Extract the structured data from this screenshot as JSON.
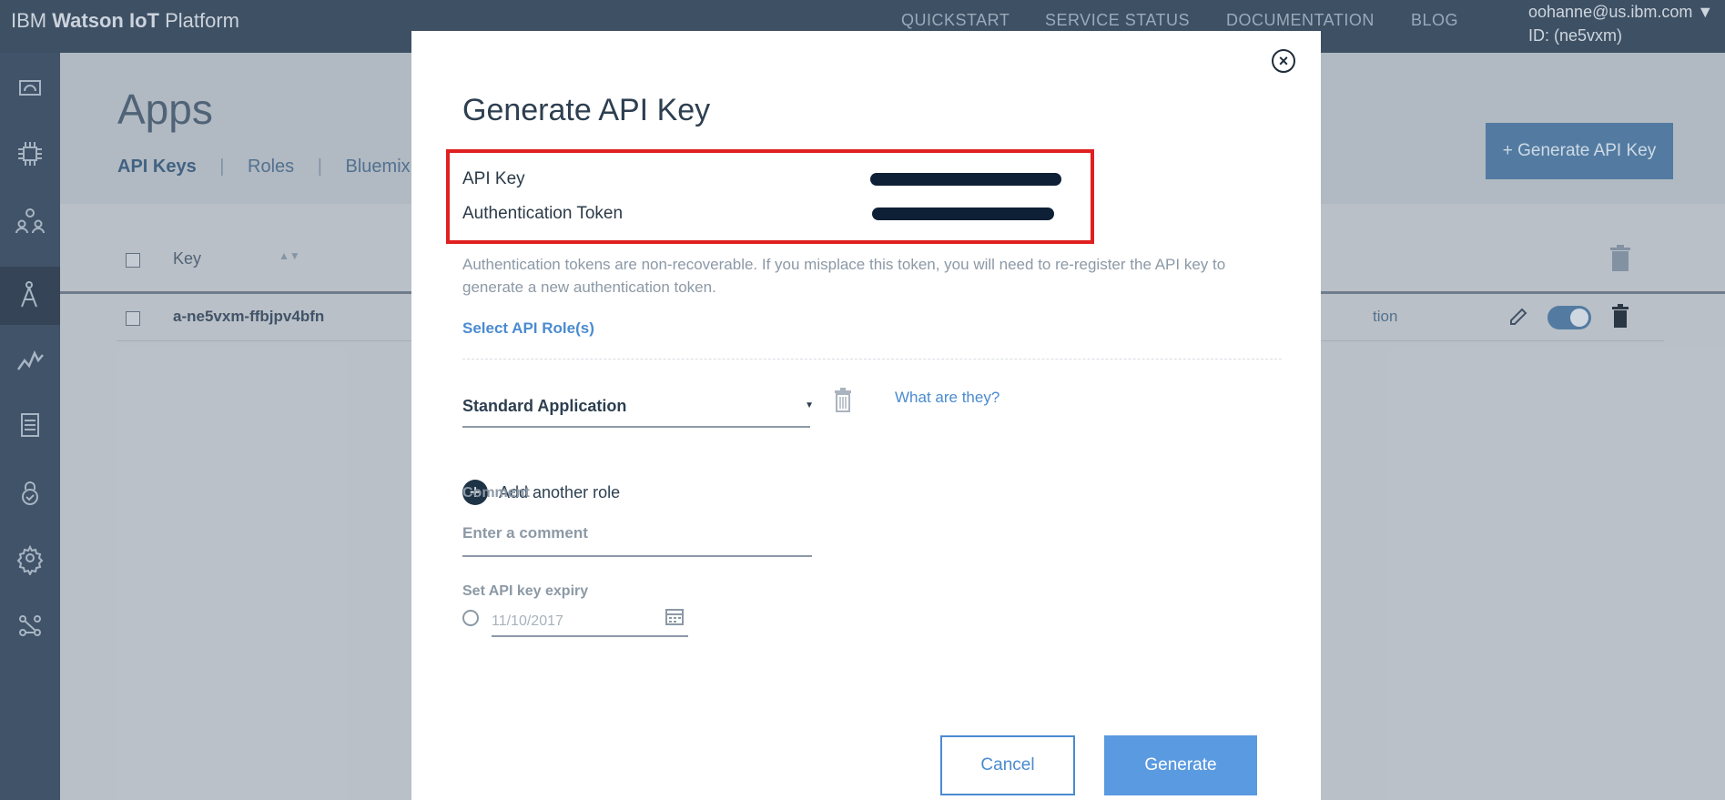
{
  "topbar": {
    "brand_prefix": "IBM ",
    "brand_bold": "Watson IoT",
    "brand_suffix": " Platform",
    "nav": [
      "QUICKSTART",
      "SERVICE STATUS",
      "DOCUMENTATION",
      "BLOG"
    ],
    "user_email": "oohanne@us.ibm.com ▼",
    "user_id": "ID: (ne5vxm)"
  },
  "sidebar": {
    "icons": [
      "dashboard-icon",
      "devices-icon",
      "members-icon",
      "apps-icon",
      "usage-icon",
      "rules-icon",
      "security-icon",
      "settings-icon",
      "extensions-icon"
    ],
    "active_index": 3
  },
  "page": {
    "title": "Apps",
    "tabs": [
      "API Keys",
      "Roles",
      "Bluemix Ap"
    ],
    "generate_button": "+ Generate API Key",
    "table": {
      "column_key": "Key",
      "row_key": "a-ne5vxm-ffbjpv4bfn",
      "row_partial": "tion"
    }
  },
  "modal": {
    "title": "Generate API Key",
    "api_key_label": "API Key",
    "auth_token_label": "Authentication Token",
    "note": "Authentication tokens are non-recoverable. If you misplace this token, you will need to re-register the API key to generate a new authentication token.",
    "select_roles_link": "Select API Role(s)",
    "role_value": "Standard Application",
    "what_link": "What are they?",
    "add_role": "Add another role",
    "comment_label": "Comment",
    "comment_placeholder": "Enter a comment",
    "expiry_label": "Set API key expiry",
    "expiry_date": "11/10/2017",
    "cancel": "Cancel",
    "generate": "Generate",
    "colors": {
      "accent": "#4a8bd0",
      "highlight": "#e02020",
      "primary_button": "#5a9ae0"
    }
  }
}
